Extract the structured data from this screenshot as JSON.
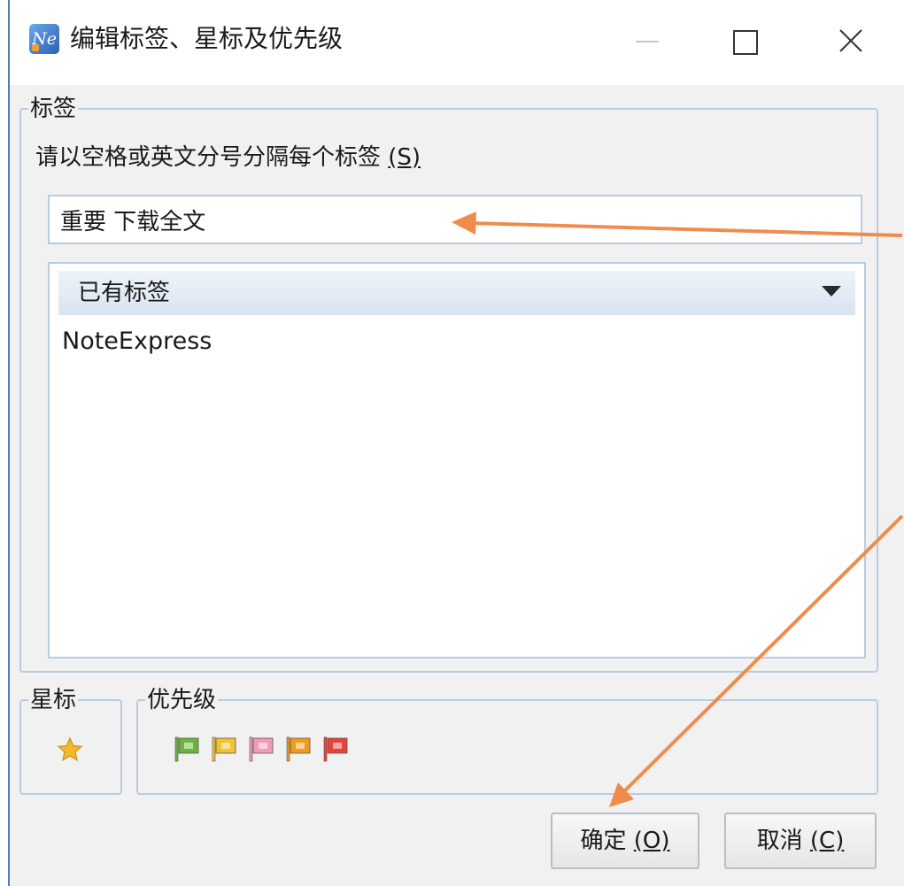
{
  "window": {
    "title": "编辑标签、星标及优先级",
    "app_icon": "Ne"
  },
  "tags": {
    "group_label": "标签",
    "instruction": "请以空格或英文分号分隔每个标签 ",
    "instruction_accel": "(S)",
    "input_value": "重要 下载全文",
    "existing_header": "已有标签",
    "existing_items": [
      "NoteExpress"
    ]
  },
  "star": {
    "group_label": "星标",
    "icon": "star-icon",
    "color": "#f3b72a"
  },
  "priority": {
    "group_label": "优先级",
    "flags": [
      {
        "name": "green-flag-icon",
        "color": "#6cb33e"
      },
      {
        "name": "yellow-flag-icon",
        "color": "#f1c232"
      },
      {
        "name": "pink-flag-icon",
        "color": "#f29bb4"
      },
      {
        "name": "orange-flag-icon",
        "color": "#f19a1c"
      },
      {
        "name": "red-flag-icon",
        "color": "#e8423a"
      }
    ]
  },
  "buttons": {
    "ok_label": "确定 ",
    "ok_accel": "(O)",
    "cancel_label": "取消 ",
    "cancel_accel": "(C)"
  },
  "annotation": {
    "arrow_color": "#ef8c4c"
  }
}
